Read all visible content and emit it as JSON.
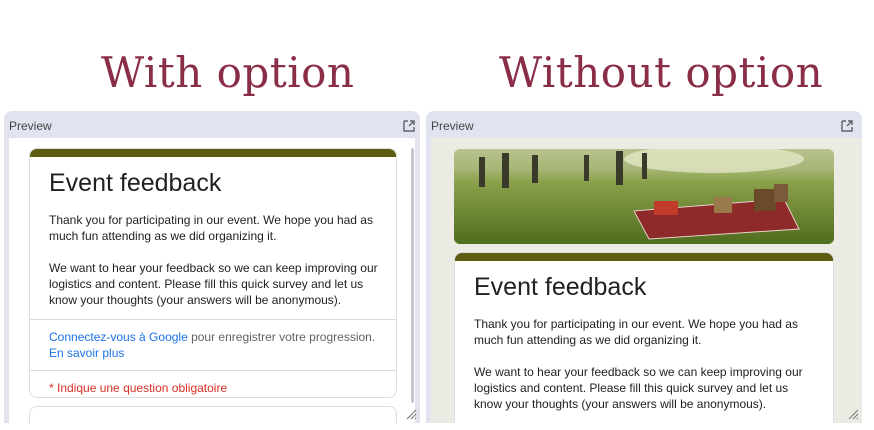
{
  "headings": {
    "with": "With option",
    "without": "Without option"
  },
  "panels": {
    "label": "Preview",
    "external_icon": "open-in-new-icon",
    "resize_icon": "resize-handle-icon"
  },
  "form": {
    "title": "Event feedback",
    "description_p1": "Thank you for participating in our event. We hope you had as much fun attending as we did organizing it.",
    "description_p2": "We want to hear your feedback so we can keep improving our logistics and content. Please fill this quick survey and let us know your thoughts (your answers will be anonymous).",
    "signin_link": "Connectez-vous à Google",
    "signin_text": " pour enregistrer votre progression.",
    "learn_more": "En savoir plus",
    "required_note": "* Indique une question obligatoire"
  },
  "colors": {
    "heading": "#8a2d47",
    "theme": "#5d5e12",
    "link": "#1a73e8",
    "required": "#d93025",
    "panel_bg": "#e1e4f0",
    "form_bg_right": "#ecebe3"
  },
  "banner": {
    "image": "picnic-field-photo"
  },
  "feedback_icon": "report-feedback-icon"
}
